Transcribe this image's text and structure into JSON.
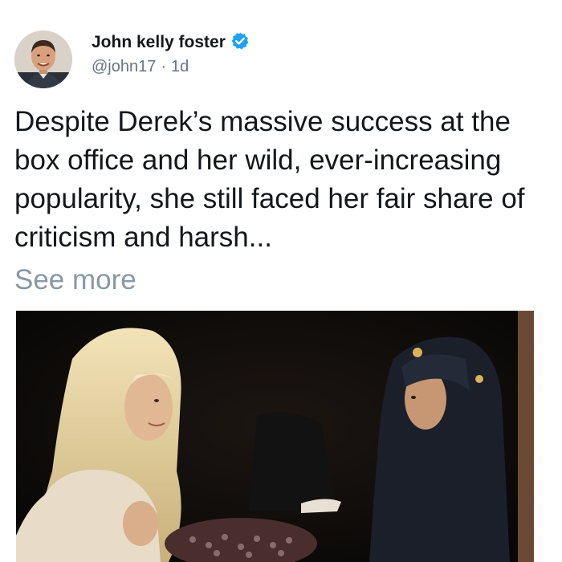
{
  "post": {
    "author_name": "John kelly foster",
    "handle": "@john17",
    "separator": "·",
    "time": "1d",
    "text": "Despite Derek’s massive success at the box office and her wild, ever-increasing popularity, she still faced her fair share of criticism and harsh...",
    "see_more": "See more"
  },
  "icons": {
    "verified": "verified-badge-icon",
    "avatar": "profile-photo"
  },
  "colors": {
    "verified_blue": "#1da1f2",
    "text": "#14171a",
    "secondary": "#657786",
    "see_more": "#8899a6"
  }
}
